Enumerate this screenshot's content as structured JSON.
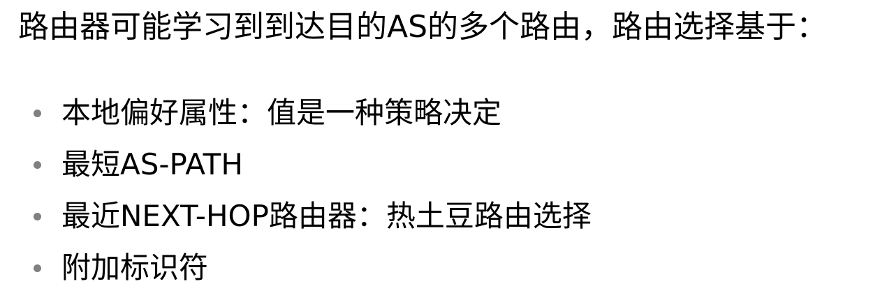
{
  "slide": {
    "intro_text": "路由器可能学习到到达目的AS的多个路由，路由选择基于：",
    "bullets": [
      "本地偏好属性：值是一种策略决定",
      "最短AS-PATH",
      "最近NEXT-HOP路由器：热土豆路由选择",
      "附加标识符"
    ]
  }
}
